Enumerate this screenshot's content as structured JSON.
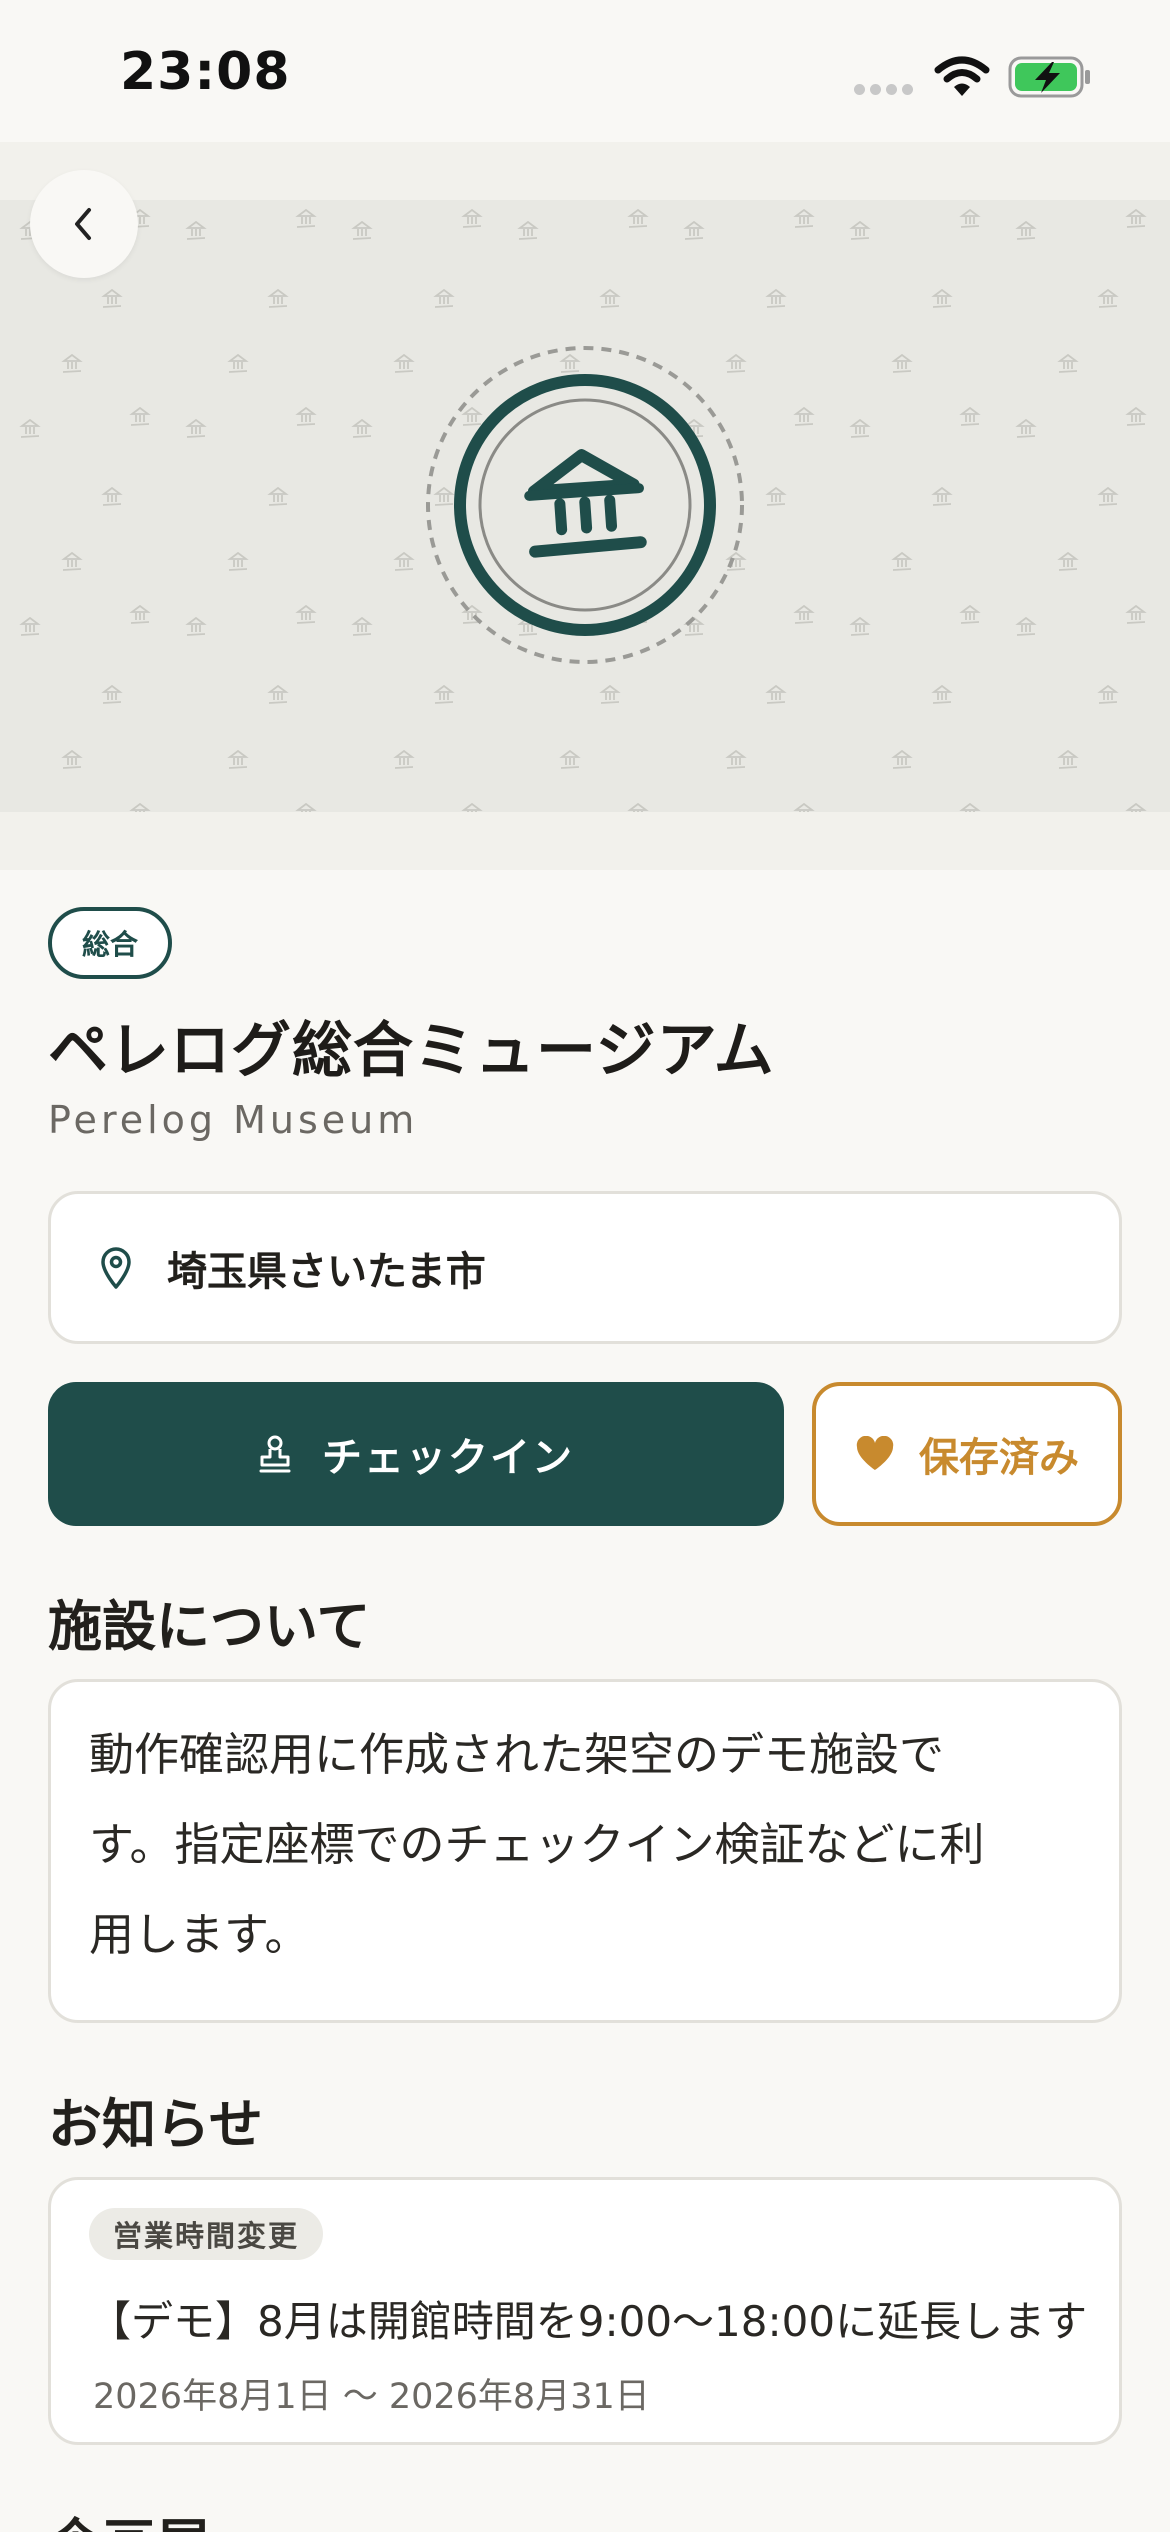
{
  "status_bar": {
    "time": "23:08",
    "icons": [
      "cellular-signal-icon",
      "wifi-icon",
      "battery-charging-icon"
    ]
  },
  "hero": {
    "back_icon": "chevron-left-icon",
    "emblem_icon": "museum-building-icon",
    "pattern_icon": "museum-building-icon"
  },
  "facility": {
    "category": "総合",
    "name": "ペレログ総合ミュージアム",
    "name_en": "Perelog Museum",
    "address": "埼玉県さいたま市"
  },
  "actions": {
    "checkin_label": "チェックイン",
    "saved_label": "保存済み"
  },
  "about": {
    "heading": "施設について",
    "description_lines": [
      "動作確認用に作成された架空のデモ施設で",
      "す。指定座標でのチェックイン検証などに利",
      "用します。"
    ]
  },
  "notices": {
    "heading": "お知らせ",
    "items": [
      {
        "tag": "営業時間変更",
        "title": "【デモ】8月は開館時間を9:00〜18:00に延長します",
        "dates": "2026年8月1日 〜 2026年8月31日"
      }
    ]
  },
  "next_section": {
    "heading": "企画展"
  },
  "colors": {
    "primary": "#1f4d4a",
    "accent": "#c88a2e",
    "background": "#f9f8f5",
    "card_border": "#e2e0da",
    "battery_green": "#3fc75b"
  }
}
